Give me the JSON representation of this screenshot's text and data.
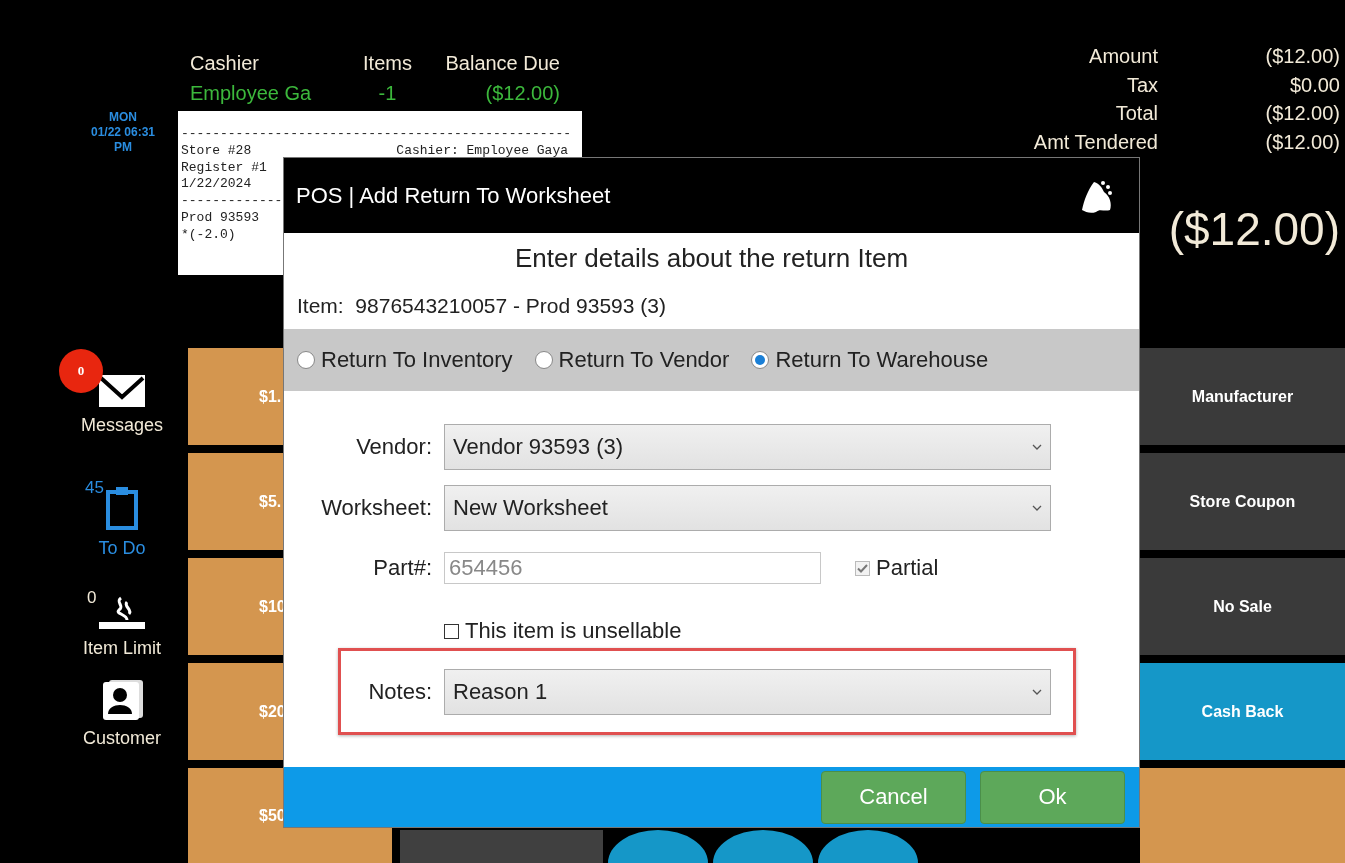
{
  "clock": {
    "lines": [
      "MON",
      "01/22 06:31",
      "PM"
    ]
  },
  "header": {
    "columns": [
      {
        "label": "Cashier",
        "value": "Employee Ga"
      },
      {
        "label": "Items",
        "value": "-1"
      },
      {
        "label": "Balance Due",
        "value": "($12.00)"
      }
    ]
  },
  "receipt": {
    "lines": [
      {
        "left": "--------------------------------------------------"
      },
      {
        "left": "Store #28",
        "right": "Cashier: Employee Gaya"
      },
      {
        "left": "Register #1"
      },
      {
        "left": "1/22/2024"
      },
      {
        "left": "-------------"
      },
      {
        "left": "Prod 93593"
      },
      {
        "left": "*(-2.0)"
      }
    ]
  },
  "totals": [
    {
      "label": "Amount",
      "value": "($12.00)"
    },
    {
      "label": "Tax",
      "value": "$0.00"
    },
    {
      "label": "Total",
      "value": "($12.00)"
    },
    {
      "label": "Amt Tendered",
      "value": "($12.00)"
    }
  ],
  "balance": "($12.00)",
  "sidebar": [
    {
      "kind": "messages",
      "label": "Messages",
      "badge": "0"
    },
    {
      "kind": "todo",
      "label": "To Do",
      "count": "45"
    },
    {
      "kind": "item_limit",
      "label": "Item Limit",
      "count": "0"
    },
    {
      "kind": "customer",
      "label": "Customer"
    }
  ],
  "tender_buttons": [
    "$1.",
    "$5.",
    "$10",
    "$20",
    "$50"
  ],
  "function_buttons": [
    {
      "label": "Manufacturer",
      "color": "#3a3a3a"
    },
    {
      "label": "Store Coupon",
      "color": "#3a3a3a"
    },
    {
      "label": "No Sale",
      "color": "#3a3a3a"
    },
    {
      "label": "Cash Back",
      "color": "#1597c8"
    },
    {
      "color": "#d4964f"
    }
  ],
  "bottom_buttons": [
    {
      "kind": "square"
    },
    {
      "kind": "round"
    },
    {
      "kind": "round"
    },
    {
      "kind": "round"
    }
  ],
  "dialog": {
    "title": "POS | Add Return To Worksheet",
    "heading": "Enter details about the return Item",
    "item": "Item:  9876543210057 - Prod 93593 (3)",
    "return_options": [
      {
        "label": "Return To Inventory",
        "selected": false
      },
      {
        "label": "Return To Vendor",
        "selected": false
      },
      {
        "label": "Return To Warehouse",
        "selected": true
      }
    ],
    "vendor": {
      "label": "Vendor:",
      "value": "Vendor 93593 (3)"
    },
    "worksheet": {
      "label": "Worksheet:",
      "value": "New Worksheet"
    },
    "part": {
      "label": "Part#:",
      "value": "654456",
      "disabled": true
    },
    "partial": {
      "label": "Partial",
      "checked": true,
      "disabled": true
    },
    "unsellable": {
      "label": "This item is unsellable",
      "checked": false
    },
    "notes": {
      "label": "Notes:",
      "value": "Reason 1",
      "highlighted": true
    },
    "buttons": [
      "Cancel",
      "Ok"
    ]
  }
}
